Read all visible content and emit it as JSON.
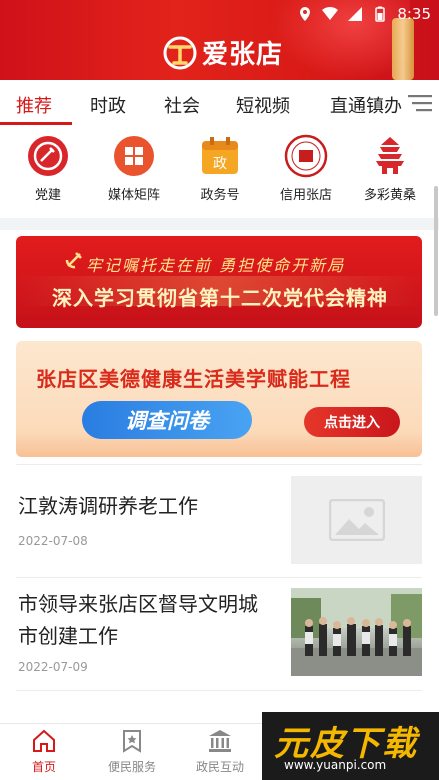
{
  "status_bar": {
    "time": "8:35",
    "icons": [
      "location-icon",
      "wifi-icon",
      "signal-icon",
      "battery-icon"
    ]
  },
  "header": {
    "app_name": "爱张店",
    "brand_color": "#d61a1a"
  },
  "tabs": [
    {
      "label": "推荐",
      "active": true
    },
    {
      "label": "时政",
      "active": false
    },
    {
      "label": "社会",
      "active": false
    },
    {
      "label": "短视频",
      "active": false
    },
    {
      "label": "直通镇办",
      "active": false
    }
  ],
  "shortcuts": [
    {
      "label": "党建",
      "icon": "party-emblem-icon"
    },
    {
      "label": "媒体矩阵",
      "icon": "grid-icon"
    },
    {
      "label": "政务号",
      "icon": "calendar-gov-icon"
    },
    {
      "label": "信用张店",
      "icon": "credit-seal-icon"
    },
    {
      "label": "多彩黄桑",
      "icon": "pagoda-icon"
    }
  ],
  "banners": {
    "banner1": {
      "line1": "牢记嘱托走在前  勇担使命开新局",
      "line2": "深入学习贯彻省第十二次党代会精神"
    },
    "banner2": {
      "title": "张店区美德健康生活美学赋能工程",
      "pill": "调查问卷",
      "enter": "点击进入"
    }
  },
  "news": [
    {
      "title": "江敦涛调研养老工作",
      "date": "2022-07-08",
      "thumb": "placeholder"
    },
    {
      "title": "市领导来张店区督导文明城市创建工作",
      "date": "2022-07-09",
      "thumb": "photo"
    }
  ],
  "bottom_nav": [
    {
      "label": "首页",
      "icon": "home-icon",
      "active": true
    },
    {
      "label": "便民服务",
      "icon": "service-icon",
      "active": false
    },
    {
      "label": "政民互动",
      "icon": "government-building-icon",
      "active": false
    }
  ],
  "watermark": {
    "brand": "元皮下载",
    "url": "www.yuanpi.com"
  }
}
